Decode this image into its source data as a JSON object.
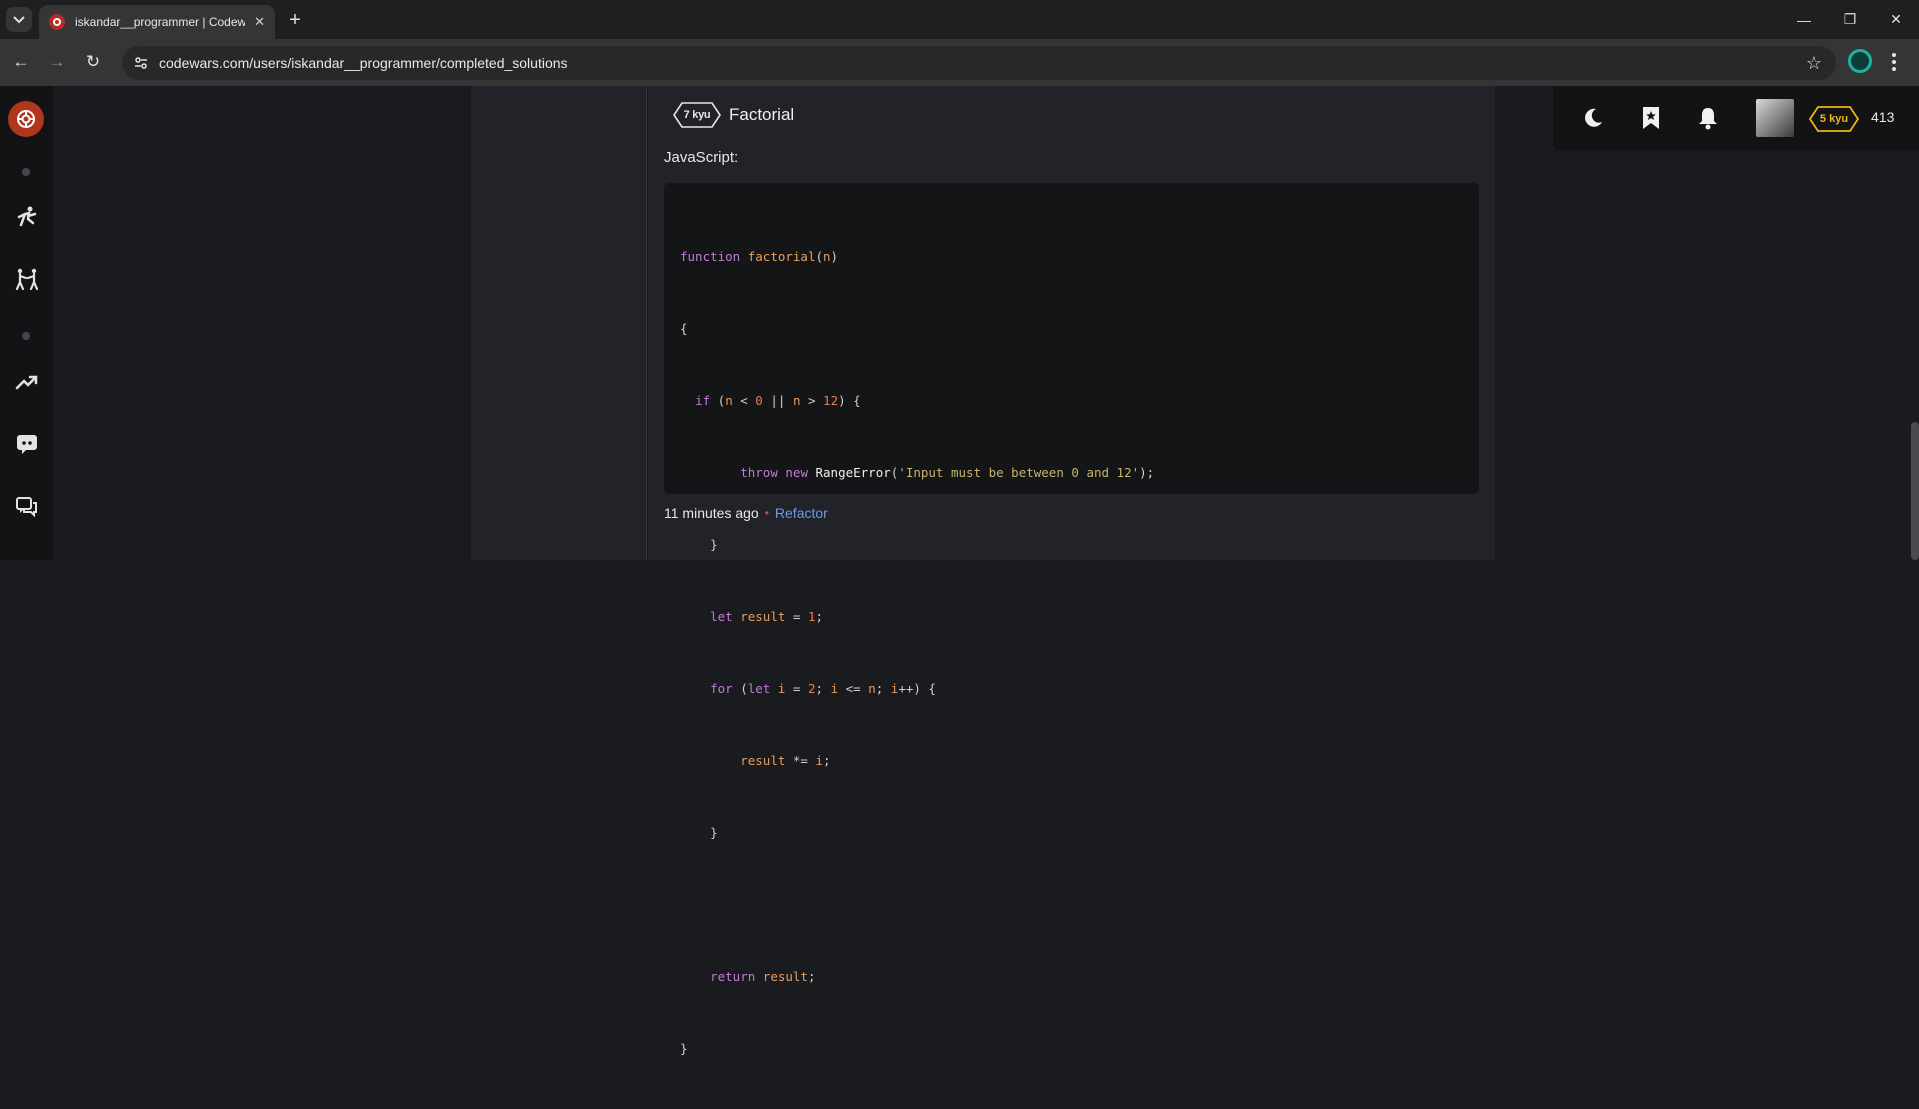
{
  "browser": {
    "tab_title": "iskandar__programmer | Codewars",
    "url": "codewars.com/users/iskandar__programmer/completed_solutions"
  },
  "colors": {
    "brand": "#b1361e",
    "link": "#6b9be8",
    "rank_yellow": "#ecb613"
  },
  "kata": {
    "kyu": "7 kyu",
    "title": "Factorial",
    "language": "JavaScript:",
    "code_lines": [
      "function factorial(n)",
      "{",
      "  if (n < 0 || n > 12) {",
      "        throw new RangeError('Input must be between 0 and 12');",
      "    }",
      "    let result = 1;",
      "    for (let i = 2; i <= n; i++) {",
      "        result *= i;",
      "    }",
      "",
      "    return result;",
      "}"
    ],
    "time_ago": "11 minutes ago",
    "refactor_label": "Refactor"
  },
  "user": {
    "rank": "5 kyu",
    "honor": "413"
  }
}
